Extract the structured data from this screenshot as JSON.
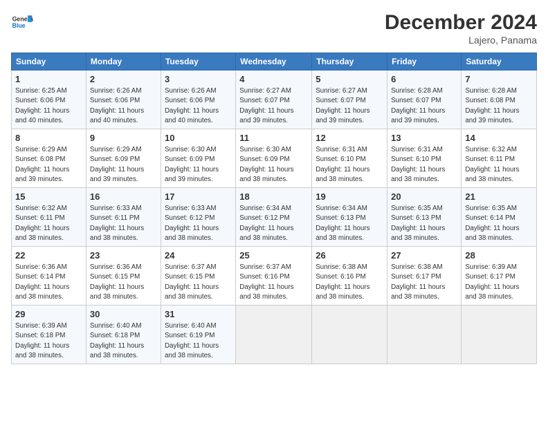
{
  "header": {
    "title": "December 2024",
    "subtitle": "Lajero, Panama"
  },
  "columns": [
    "Sunday",
    "Monday",
    "Tuesday",
    "Wednesday",
    "Thursday",
    "Friday",
    "Saturday"
  ],
  "weeks": [
    [
      {
        "day": "1",
        "info": "Sunrise: 6:25 AM\nSunset: 6:06 PM\nDaylight: 11 hours\nand 40 minutes."
      },
      {
        "day": "2",
        "info": "Sunrise: 6:26 AM\nSunset: 6:06 PM\nDaylight: 11 hours\nand 40 minutes."
      },
      {
        "day": "3",
        "info": "Sunrise: 6:26 AM\nSunset: 6:06 PM\nDaylight: 11 hours\nand 40 minutes."
      },
      {
        "day": "4",
        "info": "Sunrise: 6:27 AM\nSunset: 6:07 PM\nDaylight: 11 hours\nand 39 minutes."
      },
      {
        "day": "5",
        "info": "Sunrise: 6:27 AM\nSunset: 6:07 PM\nDaylight: 11 hours\nand 39 minutes."
      },
      {
        "day": "6",
        "info": "Sunrise: 6:28 AM\nSunset: 6:07 PM\nDaylight: 11 hours\nand 39 minutes."
      },
      {
        "day": "7",
        "info": "Sunrise: 6:28 AM\nSunset: 6:08 PM\nDaylight: 11 hours\nand 39 minutes."
      }
    ],
    [
      {
        "day": "8",
        "info": "Sunrise: 6:29 AM\nSunset: 6:08 PM\nDaylight: 11 hours\nand 39 minutes."
      },
      {
        "day": "9",
        "info": "Sunrise: 6:29 AM\nSunset: 6:09 PM\nDaylight: 11 hours\nand 39 minutes."
      },
      {
        "day": "10",
        "info": "Sunrise: 6:30 AM\nSunset: 6:09 PM\nDaylight: 11 hours\nand 39 minutes."
      },
      {
        "day": "11",
        "info": "Sunrise: 6:30 AM\nSunset: 6:09 PM\nDaylight: 11 hours\nand 38 minutes."
      },
      {
        "day": "12",
        "info": "Sunrise: 6:31 AM\nSunset: 6:10 PM\nDaylight: 11 hours\nand 38 minutes."
      },
      {
        "day": "13",
        "info": "Sunrise: 6:31 AM\nSunset: 6:10 PM\nDaylight: 11 hours\nand 38 minutes."
      },
      {
        "day": "14",
        "info": "Sunrise: 6:32 AM\nSunset: 6:11 PM\nDaylight: 11 hours\nand 38 minutes."
      }
    ],
    [
      {
        "day": "15",
        "info": "Sunrise: 6:32 AM\nSunset: 6:11 PM\nDaylight: 11 hours\nand 38 minutes."
      },
      {
        "day": "16",
        "info": "Sunrise: 6:33 AM\nSunset: 6:11 PM\nDaylight: 11 hours\nand 38 minutes."
      },
      {
        "day": "17",
        "info": "Sunrise: 6:33 AM\nSunset: 6:12 PM\nDaylight: 11 hours\nand 38 minutes."
      },
      {
        "day": "18",
        "info": "Sunrise: 6:34 AM\nSunset: 6:12 PM\nDaylight: 11 hours\nand 38 minutes."
      },
      {
        "day": "19",
        "info": "Sunrise: 6:34 AM\nSunset: 6:13 PM\nDaylight: 11 hours\nand 38 minutes."
      },
      {
        "day": "20",
        "info": "Sunrise: 6:35 AM\nSunset: 6:13 PM\nDaylight: 11 hours\nand 38 minutes."
      },
      {
        "day": "21",
        "info": "Sunrise: 6:35 AM\nSunset: 6:14 PM\nDaylight: 11 hours\nand 38 minutes."
      }
    ],
    [
      {
        "day": "22",
        "info": "Sunrise: 6:36 AM\nSunset: 6:14 PM\nDaylight: 11 hours\nand 38 minutes."
      },
      {
        "day": "23",
        "info": "Sunrise: 6:36 AM\nSunset: 6:15 PM\nDaylight: 11 hours\nand 38 minutes."
      },
      {
        "day": "24",
        "info": "Sunrise: 6:37 AM\nSunset: 6:15 PM\nDaylight: 11 hours\nand 38 minutes."
      },
      {
        "day": "25",
        "info": "Sunrise: 6:37 AM\nSunset: 6:16 PM\nDaylight: 11 hours\nand 38 minutes."
      },
      {
        "day": "26",
        "info": "Sunrise: 6:38 AM\nSunset: 6:16 PM\nDaylight: 11 hours\nand 38 minutes."
      },
      {
        "day": "27",
        "info": "Sunrise: 6:38 AM\nSunset: 6:17 PM\nDaylight: 11 hours\nand 38 minutes."
      },
      {
        "day": "28",
        "info": "Sunrise: 6:39 AM\nSunset: 6:17 PM\nDaylight: 11 hours\nand 38 minutes."
      }
    ],
    [
      {
        "day": "29",
        "info": "Sunrise: 6:39 AM\nSunset: 6:18 PM\nDaylight: 11 hours\nand 38 minutes."
      },
      {
        "day": "30",
        "info": "Sunrise: 6:40 AM\nSunset: 6:18 PM\nDaylight: 11 hours\nand 38 minutes."
      },
      {
        "day": "31",
        "info": "Sunrise: 6:40 AM\nSunset: 6:19 PM\nDaylight: 11 hours\nand 38 minutes."
      },
      null,
      null,
      null,
      null
    ]
  ]
}
